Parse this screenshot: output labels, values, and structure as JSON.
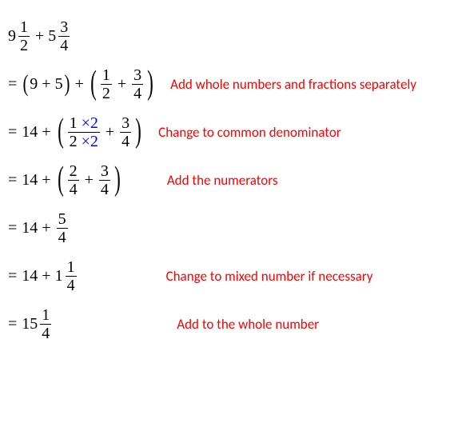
{
  "problem": {
    "term1_whole": "9",
    "term1_num": "1",
    "term1_den": "2",
    "term2_whole": "5",
    "term2_num": "3",
    "term2_den": "4"
  },
  "step1": {
    "whole1": "9",
    "whole2": "5",
    "f1_num": "1",
    "f1_den": "2",
    "f2_num": "3",
    "f2_den": "4",
    "explain": "Add whole numbers and fractions separately"
  },
  "step2": {
    "whole": "14",
    "f1_num": "1",
    "mult_num": "×2",
    "f1_den": "2",
    "mult_den": "×2",
    "f2_num": "3",
    "f2_den": "4",
    "explain": "Change to common denominator"
  },
  "step3": {
    "whole": "14",
    "f1_num": "2",
    "f1_den": "4",
    "f2_num": "3",
    "f2_den": "4",
    "explain": "Add the numerators"
  },
  "step4": {
    "whole": "14",
    "f_num": "5",
    "f_den": "4"
  },
  "step5": {
    "whole": "14",
    "mixed_whole": "1",
    "mixed_num": "1",
    "mixed_den": "4",
    "explain": "Change to mixed number if necessary"
  },
  "step6": {
    "mixed_whole": "15",
    "mixed_num": "1",
    "mixed_den": "4",
    "explain": "Add to the whole number"
  },
  "ops": {
    "plus": "+",
    "eq": "=",
    "lparen": "(",
    "rparen": ")"
  }
}
